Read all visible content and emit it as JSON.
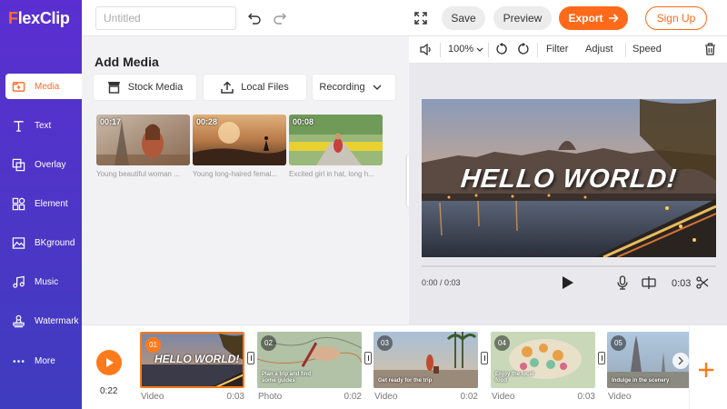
{
  "app": {
    "logo_text": "lexClip",
    "logo_mark": "F"
  },
  "sidebar": {
    "items": [
      {
        "label": "Media",
        "icon": "media-icon",
        "active": true
      },
      {
        "label": "Text",
        "icon": "text-icon"
      },
      {
        "label": "Overlay",
        "icon": "overlay-icon"
      },
      {
        "label": "Element",
        "icon": "element-icon"
      },
      {
        "label": "BKground",
        "icon": "background-icon"
      },
      {
        "label": "Music",
        "icon": "music-icon"
      },
      {
        "label": "Watermark",
        "icon": "watermark-icon"
      },
      {
        "label": "More",
        "icon": "more-icon"
      }
    ]
  },
  "topbar": {
    "title_placeholder": "Untitled",
    "save_label": "Save",
    "preview_label": "Preview",
    "export_label": "Export",
    "signup_label": "Sign Up"
  },
  "media": {
    "title": "Add Media",
    "stock_label": "Stock Media",
    "local_label": "Local Files",
    "recording_label": "Recording",
    "items": [
      {
        "duration": "00:17",
        "caption": "Young beautiful woman ..."
      },
      {
        "duration": "00:28",
        "caption": "Young long-haired femal..."
      },
      {
        "duration": "00:08",
        "caption": "Excited girl in hat, long h..."
      }
    ]
  },
  "preview": {
    "zoom": "100%",
    "filter_label": "Filter",
    "adjust_label": "Adjust",
    "speed_label": "Speed",
    "overlay_text": "HELLO WORLD!",
    "time_current": "0:00 / 0:03",
    "clip_duration": "0:03"
  },
  "timeline": {
    "total_time": "0:22",
    "clips": [
      {
        "num": "01",
        "caption": "HELLO WORLD!",
        "type": "Video",
        "duration": "0:03",
        "selected": true
      },
      {
        "num": "02",
        "caption": "Plan a trip and find some guides",
        "type": "Photo",
        "duration": "0:02"
      },
      {
        "num": "03",
        "caption": "Get ready for the trip",
        "type": "Video",
        "duration": "0:02"
      },
      {
        "num": "04",
        "caption": "Enjoy the local food",
        "type": "Video",
        "duration": "0:03"
      },
      {
        "num": "05",
        "caption": "Indulge in the scenery",
        "type": "Video",
        "duration": ""
      }
    ]
  },
  "colors": {
    "accent": "#ff6a1a",
    "sidebar_top": "#5b2fd1",
    "sidebar_bottom": "#3f3cbf"
  }
}
